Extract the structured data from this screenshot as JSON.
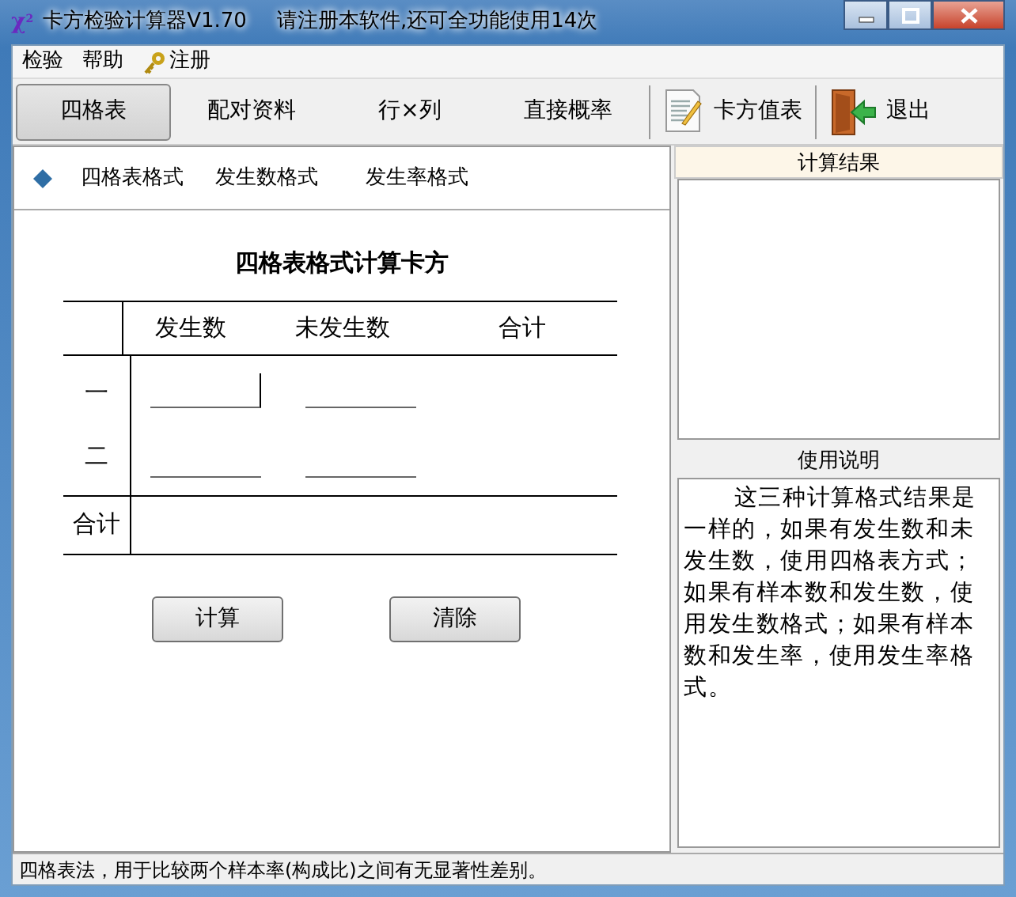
{
  "window": {
    "icon": "χ$^{2}$",
    "title": "卡方检验计算器V1.70",
    "notice": "请注册本软件,还可全功能使用14次"
  },
  "menu": [
    {
      "label": "检验",
      "kind": "plain"
    },
    {
      "label": "帮助",
      "kind": "plain"
    },
    {
      "label": "注册",
      "kind": "key"
    }
  ],
  "toolbar": [
    {
      "kind": "tab",
      "label": "四格表",
      "selected": true
    },
    {
      "kind": "tab",
      "label": "配对资料",
      "selected": false
    },
    {
      "kind": "tab",
      "label": "行×列",
      "selected": false
    },
    {
      "kind": "tab",
      "label": "直接概率",
      "selected": false
    },
    {
      "kind": "table",
      "label": "卡方值表"
    },
    {
      "kind": "exit",
      "label": "退出"
    }
  ],
  "formats": [
    {
      "label": "四格表格式",
      "selected": true
    },
    {
      "label": "发生数格式",
      "selected": false
    },
    {
      "label": "发生率格式",
      "selected": false
    }
  ],
  "table": {
    "title": "四格表格式计算卡方",
    "columns": [
      "发生数",
      "未发生数",
      "合计"
    ],
    "rows": [
      {
        "label": "一",
        "fields": [
          {
            "focused": true
          },
          {
            "focused": false
          }
        ]
      },
      {
        "label": "二",
        "fields": [
          {
            "focused": false
          },
          {
            "focused": false
          }
        ]
      }
    ],
    "total_label": "合计"
  },
  "buttons": [
    "计算",
    "清除"
  ],
  "results": {
    "title": "计算结果"
  },
  "help": {
    "title": "使用说明",
    "text": "这三种计算格式结果是一样的，如果有发生数和未发生数，使用四格表方式；如果有样本数和发生数，使用发生数格式；如果有样本数和发生率，使用发生率格式。"
  },
  "status_bar": "四格表法，用于比较两个样本率(构成比)之间有无显著性差别。"
}
